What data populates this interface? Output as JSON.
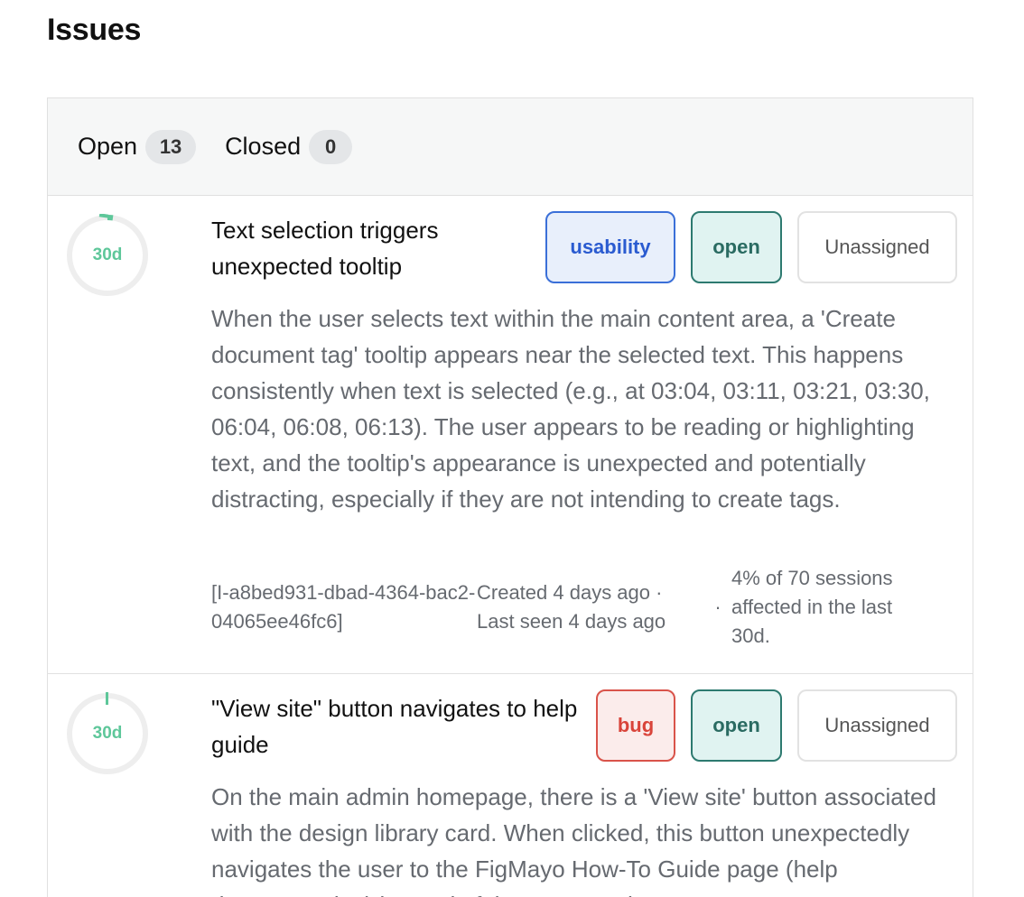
{
  "page": {
    "title": "Issues"
  },
  "tabs": [
    {
      "label": "Open",
      "count": "13"
    },
    {
      "label": "Closed",
      "count": "0"
    }
  ],
  "issues": [
    {
      "age": "30d",
      "title": "Text selection triggers unexpected tooltip",
      "category": "usability",
      "status": "open",
      "assignee": "Unassigned",
      "description": "When the user selects text within the main content area, a 'Create document tag' tooltip appears near the selected text. This happens consistently when text is selected (e.g., at 03:04, 03:11, 03:21, 03:30, 06:04, 06:08, 06:13). The user appears to be reading or highlighting text, and the tooltip's appearance is unexpected and potentially distracting, especially if they are not intending to create tags.",
      "id": "[I-a8bed931-dbad-4364-bac2-04065ee46fc6]",
      "dates": "Created 4 days ago · Last seen 4 days ago",
      "separator": "·",
      "sessions": "4% of 70 sessions affected in the last 30d."
    },
    {
      "age": "30d",
      "title": "\"View site\" button navigates to help guide",
      "category": "bug",
      "status": "open",
      "assignee": "Unassigned",
      "description": "On the main admin homepage, there is a 'View site' button associated with the design library card. When clicked, this button unexpectedly navigates the user to the FigMayo How-To Guide page (help documentation) instead of the generated"
    }
  ],
  "colors": {
    "ring_track": "#eeeeee",
    "ring_progress": "#5ec79a",
    "usability": "#3a6fd8",
    "bug": "#d9534a",
    "open": "#2d7a70"
  }
}
